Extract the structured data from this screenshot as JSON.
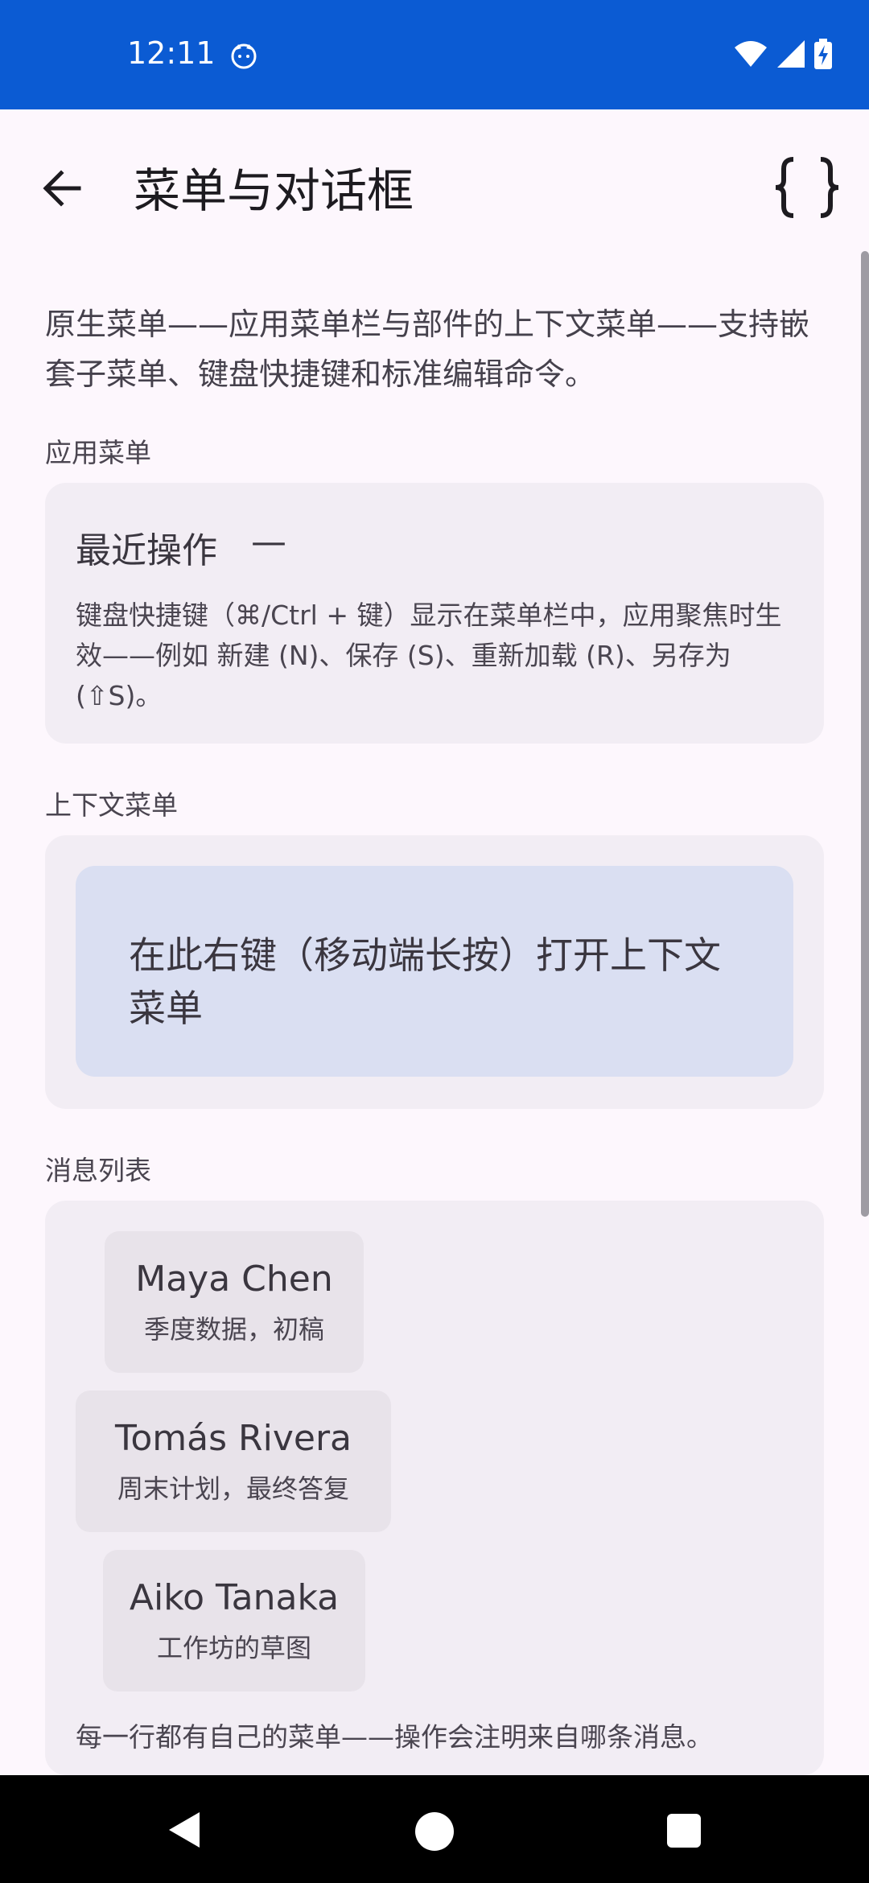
{
  "status_bar": {
    "time": "12:11"
  },
  "app_bar": {
    "title": "菜单与对话框"
  },
  "intro": "原生菜单——应用菜单栏与部件的上下文菜单——支持嵌套子菜单、键盘快捷键和标准编辑命令。",
  "app_menu": {
    "section_label": "应用菜单",
    "heading": "最近操作",
    "dash": "—",
    "note": "键盘快捷键（⌘/Ctrl + 键）显示在菜单栏中，应用聚焦时生效——例如 新建 (N)、保存 (S)、重新加载 (R)、另存为 (⇧S)。"
  },
  "context_menu": {
    "section_label": "上下文菜单",
    "area_text": "在此右键（移动端长按）打开上下文菜单"
  },
  "message_list": {
    "section_label": "消息列表",
    "items": [
      {
        "name": "Maya Chen",
        "subject": "季度数据，初稿"
      },
      {
        "name": "Tomás Rivera",
        "subject": "周末计划，最终答复"
      },
      {
        "name": "Aiko Tanaka",
        "subject": "工作坊的草图"
      }
    ],
    "footer": "每一行都有自己的菜单——操作会注明来自哪条消息。"
  },
  "colors": {
    "status_bar": "#0b5bd3",
    "background": "#fdf7fd",
    "card": "#f2edf4",
    "context_area": "#dadff2"
  },
  "icons": {
    "back": "arrow-left-icon",
    "code": "curly-braces-icon",
    "wifi": "wifi-icon",
    "signal": "signal-icon",
    "battery": "battery-charging-icon"
  }
}
